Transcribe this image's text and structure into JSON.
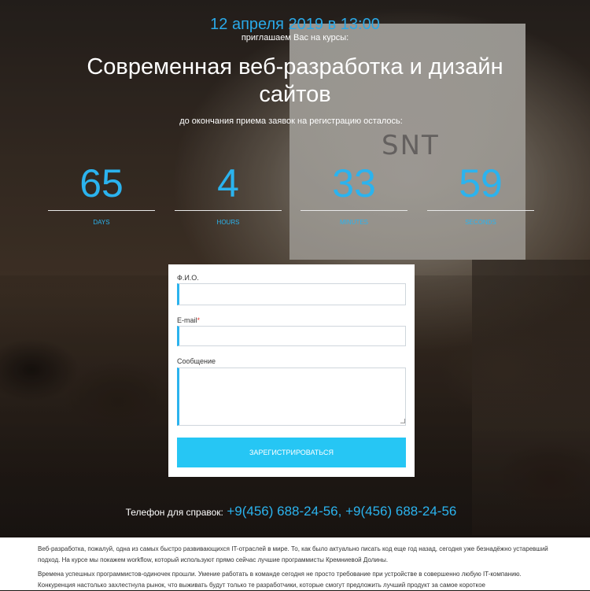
{
  "header": {
    "date": "12 апреля 2019 в 13:00",
    "invite": "приглашаем Вас на курсы:",
    "title": "Современная веб-разработка и дизайн сайтов",
    "deadline": "до окончания приема заявок на регистрацию осталось:"
  },
  "background": {
    "screen_text": "SNT"
  },
  "countdown": [
    {
      "value": "65",
      "label": "DAYS"
    },
    {
      "value": "4",
      "label": "HOURS"
    },
    {
      "value": "33",
      "label": "MINUTES"
    },
    {
      "value": "59",
      "label": "SECONDS"
    }
  ],
  "form": {
    "name_label": "Ф.И.О.",
    "email_label": "E-mail",
    "email_required": "*",
    "message_label": "Сообщение",
    "submit_label": "ЗАРЕГИСТРИРОВАТЬСЯ"
  },
  "contact": {
    "phone_label": "Телефон для справок:",
    "phones": "+9(456) 688-24-56, +9(456) 688-24-56"
  },
  "description": {
    "paragraph1": "Веб-разработка, пожалуй, одна из самых быстро развивающихся IT-отраслей в мире. То, как было актуально писать код еще год назад, сегодня уже безнадёжно устаревший подход. На курсе мы покажем workflow, который используют прямо сейчас лучшие программисты Кремниевой Долины.",
    "paragraph2": "Времена успешных программистов-одиночек прошли. Умение работать в команде сегодня не просто требование при устройстве в совершенно любую IT-компанию. Конкуренция настолько захлестнула рынок, что выживать будут только те разработчики, которые смогут предложить лучший продукт за самое короткое"
  },
  "colors": {
    "accent": "#2bb3ee",
    "button": "#26c6f4",
    "required": "#e2372f"
  }
}
